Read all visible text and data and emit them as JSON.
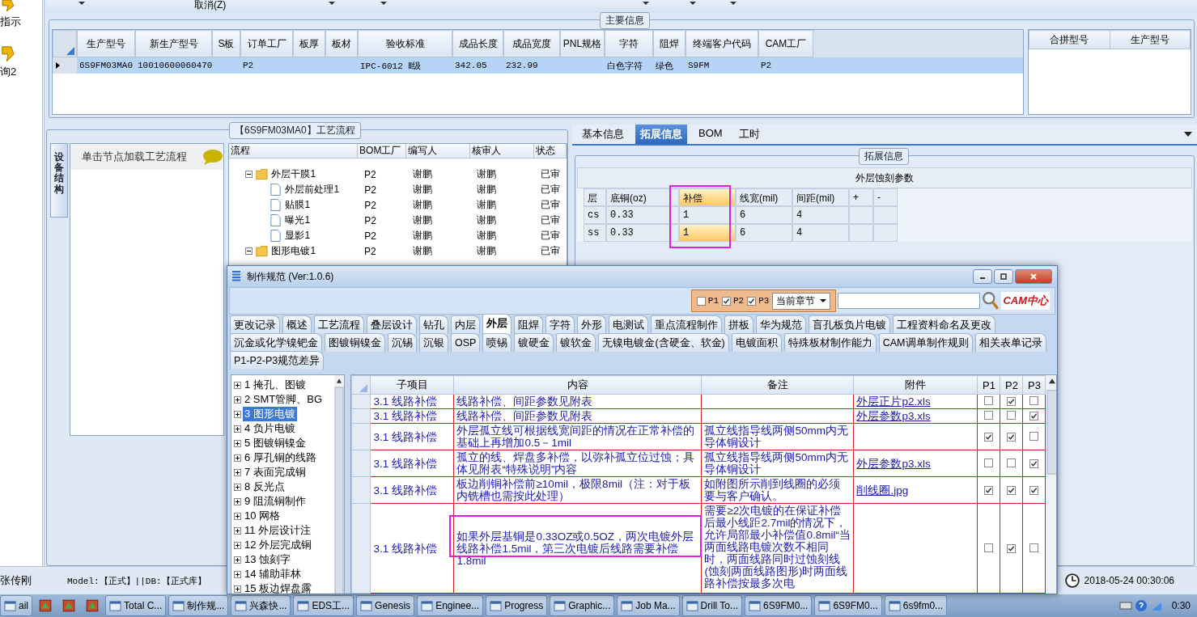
{
  "sidebar": {
    "items": [
      {
        "label": "指示"
      },
      {
        "label": "询2"
      }
    ]
  },
  "toolbar": {
    "cancel": "取消(Z)"
  },
  "main_info": {
    "title": "主要信息",
    "columns": [
      "生产型号",
      "新生产型号",
      "S板",
      "订单工厂",
      "板厚",
      "板材",
      "验收标准",
      "成品长度",
      "成品宽度",
      "PNL规格",
      "字符",
      "阻焊",
      "终端客户代码",
      "CAM工厂"
    ],
    "rows": [
      {
        "selected": true,
        "cells": [
          "6S9FM03MA0",
          "10010600060470",
          "",
          "P2",
          "",
          "",
          "IPC-6012 Ⅱ级",
          "342.05",
          "232.99",
          "",
          "白色字符",
          "绿色",
          "S9FM",
          "P2"
        ]
      }
    ],
    "merge_columns": [
      "合拼型号",
      "生产型号"
    ]
  },
  "process": {
    "title": "【6S9FM03MA0】工艺流程",
    "side_tab": "设备结构",
    "hint": "单击节点加载工艺流程",
    "columns": [
      "流程",
      "BOM工厂",
      "编写人",
      "核审人",
      "状态"
    ],
    "tree": [
      {
        "name": "外层干膜1",
        "kind": "folder",
        "expanded": true,
        "cells": [
          "P2",
          "谢鹏",
          "谢鹏",
          "已审"
        ],
        "children": [
          {
            "name": "外层前处理1",
            "kind": "file",
            "cells": [
              "P2",
              "谢鹏",
              "谢鹏",
              "已审"
            ]
          },
          {
            "name": "贴膜1",
            "kind": "file",
            "cells": [
              "P2",
              "谢鹏",
              "谢鹏",
              "已审"
            ]
          },
          {
            "name": "曝光1",
            "kind": "file",
            "cells": [
              "P2",
              "谢鹏",
              "谢鹏",
              "已审"
            ]
          },
          {
            "name": "显影1",
            "kind": "file",
            "cells": [
              "P2",
              "谢鹏",
              "谢鹏",
              "已审"
            ]
          }
        ]
      },
      {
        "name": "图形电镀1",
        "kind": "folder",
        "expanded": true,
        "cells": [
          "P2",
          "谢鹏",
          "谢鹏",
          "已审"
        ]
      }
    ]
  },
  "ext": {
    "tabs": [
      {
        "label": "基本信息",
        "selected": false
      },
      {
        "label": "拓展信息",
        "selected": true
      },
      {
        "label": "BOM",
        "selected": false
      },
      {
        "label": "工时",
        "selected": false
      }
    ],
    "group_title": "拓展信息",
    "table": {
      "title": "外层蚀刻参数",
      "columns": [
        {
          "label": "层",
          "selected": false,
          "highlighted": false
        },
        {
          "label": "底铜(oz)",
          "selected": false,
          "highlighted": false
        },
        {
          "label": "补偿",
          "selected": true,
          "highlighted": true
        },
        {
          "label": "线宽(mil)",
          "selected": false,
          "highlighted": false
        },
        {
          "label": "间距(mil)",
          "selected": false,
          "highlighted": false
        },
        {
          "label": "+",
          "selected": false,
          "highlighted": false
        },
        {
          "label": "-",
          "selected": false,
          "highlighted": false
        }
      ],
      "rows": [
        {
          "cells": [
            {
              "text": "cs",
              "selected": false
            },
            {
              "text": "0.33",
              "selected": false
            },
            {
              "text": "1",
              "selected": false
            },
            {
              "text": "6",
              "selected": false
            },
            {
              "text": "4",
              "selected": false
            },
            {
              "text": "",
              "selected": false
            },
            {
              "text": "",
              "selected": false
            }
          ]
        },
        {
          "cells": [
            {
              "text": "ss",
              "selected": false
            },
            {
              "text": "0.33",
              "selected": false
            },
            {
              "text": "1",
              "selected": true
            },
            {
              "text": "6",
              "selected": false
            },
            {
              "text": "4",
              "selected": false
            },
            {
              "text": "",
              "selected": false
            },
            {
              "text": "",
              "selected": false
            }
          ]
        }
      ]
    }
  },
  "status_bar": {
    "user": "张传刚",
    "model": "Model:【正式】||DB:【正式库】",
    "time": "2018-05-24 00:30:06"
  },
  "dialog": {
    "title": "制作规范 (Ver:1.0.6)",
    "filters": [
      {
        "label": "P1",
        "checked": false
      },
      {
        "label": "P2",
        "checked": true
      },
      {
        "label": "P3",
        "checked": true
      }
    ],
    "chapter": "当前章节",
    "logo": "CAM中心",
    "tab_rows": [
      [
        {
          "label": "更改记录",
          "selected": false
        },
        {
          "label": "概述",
          "selected": false
        },
        {
          "label": "工艺流程",
          "selected": false
        },
        {
          "label": "叠层设计",
          "selected": false
        },
        {
          "label": "钻孔",
          "selected": false
        },
        {
          "label": "内层",
          "selected": false
        },
        {
          "label": "外层",
          "selected": true
        },
        {
          "label": "阻焊",
          "selected": false
        },
        {
          "label": "字符",
          "selected": false
        },
        {
          "label": "外形",
          "selected": false
        },
        {
          "label": "电测试",
          "selected": false
        },
        {
          "label": "重点流程制作",
          "selected": false
        },
        {
          "label": "拼板",
          "selected": false
        },
        {
          "label": "华为规范",
          "selected": false
        },
        {
          "label": "盲孔板负片电镀",
          "selected": false
        },
        {
          "label": "工程资料命名及更改",
          "selected": false
        }
      ],
      [
        {
          "label": "沉金或化学镍钯金",
          "selected": false
        },
        {
          "label": "图镀铜镍金",
          "selected": false
        },
        {
          "label": "沉锡",
          "selected": false
        },
        {
          "label": "沉银",
          "selected": false
        },
        {
          "label": "OSP",
          "selected": false
        },
        {
          "label": "喷锡",
          "selected": false
        },
        {
          "label": "镀硬金",
          "selected": false
        },
        {
          "label": "镀软金",
          "selected": false
        },
        {
          "label": "无镍电镀金(含硬金、软金)",
          "selected": false
        },
        {
          "label": "电镀面积",
          "selected": false
        },
        {
          "label": "特殊板材制作能力",
          "selected": false
        },
        {
          "label": "CAM调单制作规则",
          "selected": false
        },
        {
          "label": "相关表单记录",
          "selected": false
        }
      ],
      [
        {
          "label": "P1-P2-P3规范差异",
          "selected": false
        }
      ]
    ],
    "chapters": [
      {
        "label": "1 掩孔、图镀",
        "selected": false
      },
      {
        "label": "2 SMT管脚、BG",
        "selected": false
      },
      {
        "label": "3 图形电镀",
        "selected": true
      },
      {
        "label": "4 负片电镀",
        "selected": false
      },
      {
        "label": "5 图镀铜镍金",
        "selected": false
      },
      {
        "label": "6 厚孔铜的线路",
        "selected": false
      },
      {
        "label": "7 表面完成铜",
        "selected": false
      },
      {
        "label": "8 反光点",
        "selected": false
      },
      {
        "label": "9 阻流铜制作",
        "selected": false
      },
      {
        "label": "10 网格",
        "selected": false
      },
      {
        "label": "11 外层设计注",
        "selected": false
      },
      {
        "label": "12 外层完成铜",
        "selected": false
      },
      {
        "label": "13 蚀刻字",
        "selected": false
      },
      {
        "label": "14 辅助菲林",
        "selected": false
      },
      {
        "label": "15 板边焊盘露",
        "selected": false
      }
    ],
    "columns": [
      "子项目",
      "内容",
      "备注",
      "附件",
      "P1",
      "P2",
      "P3"
    ],
    "rows": [
      {
        "sub": "3.1 线路补偿",
        "content": "线路补偿、间距参数见附表",
        "note": "",
        "attachment": "外层正片p2.xls",
        "highlighted": false,
        "flags": [
          {
            "checked": false
          },
          {
            "checked": true
          },
          {
            "checked": false
          }
        ]
      },
      {
        "sub": "3.1 线路补偿",
        "content": "线路补偿、间距参数见附表",
        "note": "",
        "attachment": "外层参数p3.xls",
        "highlighted": false,
        "flags": [
          {
            "checked": false
          },
          {
            "checked": false
          },
          {
            "checked": true
          }
        ]
      },
      {
        "sub": "3.1 线路补偿",
        "content": "外层孤立线可根据线宽间距的情况在正常补偿的基础上再增加0.5－1mil",
        "note": "孤立线指导线两侧50mm内无导体铜设计",
        "attachment": "",
        "highlighted": false,
        "flags": [
          {
            "checked": true
          },
          {
            "checked": true
          },
          {
            "checked": false
          }
        ]
      },
      {
        "sub": "3.1 线路补偿",
        "content": "孤立的线、焊盘多补偿，以弥补孤立位过蚀；具体见附表“特殊说明”内容",
        "note": "孤立线指导线两侧50mm内无导体铜设计",
        "attachment": "外层参数p3.xls",
        "highlighted": false,
        "flags": [
          {
            "checked": false
          },
          {
            "checked": false
          },
          {
            "checked": true
          }
        ]
      },
      {
        "sub": "3.1 线路补偿",
        "content": "板边削铜补偿前≥10mil，极限8mil（注：对于板内铣槽也需按此处理）",
        "note": "如附图所示削到线圈的必须要与客户确认。",
        "attachment": "削线圈.jpg",
        "highlighted": false,
        "flags": [
          {
            "checked": true
          },
          {
            "checked": true
          },
          {
            "checked": true
          }
        ]
      },
      {
        "sub": "3.1 线路补偿",
        "content": "如果外层基铜是0.33OZ或0.5OZ，两次电镀外层线路补偿1.5mil，第三次电镀后线路需要补偿1.8mil",
        "note": "需要≥2次电镀的在保证补偿后最小线距2.7mil的情况下，允许局部最小补偿值0.8mil“当两面线路电镀次数不相同时，两面线路同时过蚀刻线(蚀刻两面线路图形)时两面线路补偿按最多次电",
        "attachment": "",
        "highlighted": true,
        "flags": [
          {
            "checked": false
          },
          {
            "checked": true
          },
          {
            "checked": false
          }
        ]
      }
    ]
  },
  "taskbar": {
    "items": [
      {
        "label": "ail",
        "kind": "app"
      },
      {
        "kind": "icon"
      },
      {
        "kind": "icon"
      },
      {
        "kind": "icon"
      },
      {
        "label": "Total C...",
        "kind": "app"
      },
      {
        "label": "制作规...",
        "kind": "app"
      },
      {
        "label": "兴森快...",
        "kind": "app"
      },
      {
        "label": "EDS工...",
        "kind": "app"
      },
      {
        "label": "Genesis",
        "kind": "app"
      },
      {
        "label": "Enginee...",
        "kind": "app"
      },
      {
        "label": "Progress",
        "kind": "app"
      },
      {
        "label": "Graphic...",
        "kind": "app"
      },
      {
        "label": "Job Ma...",
        "kind": "app"
      },
      {
        "label": "Drill To...",
        "kind": "app"
      },
      {
        "label": "6S9FM0...",
        "kind": "app"
      },
      {
        "label": "6S9FM0...",
        "kind": "app"
      },
      {
        "label": "6s9fm0...",
        "kind": "app"
      }
    ],
    "clock": "0:30"
  }
}
